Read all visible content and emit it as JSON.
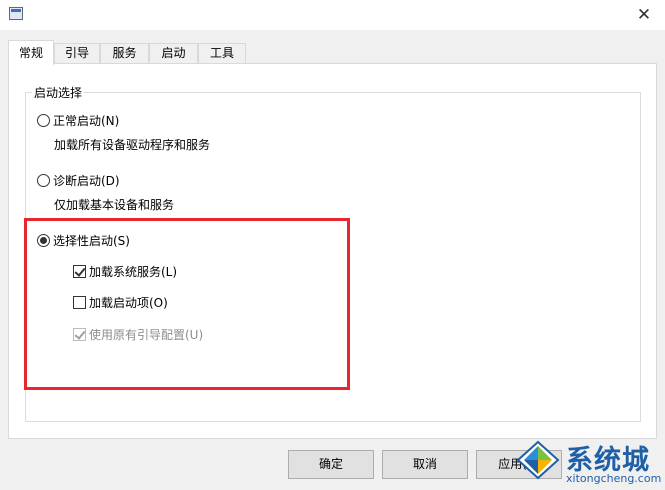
{
  "window": {
    "close_symbol": "✕"
  },
  "tabs": [
    {
      "label": "常规",
      "active": true
    },
    {
      "label": "引导"
    },
    {
      "label": "服务"
    },
    {
      "label": "启动"
    },
    {
      "label": "工具"
    }
  ],
  "startup_group": {
    "title": "启动选择",
    "normal": {
      "label": "正常启动(N)",
      "description": "加载所有设备驱动程序和服务",
      "selected": false
    },
    "diagnostic": {
      "label": "诊断启动(D)",
      "description": "仅加载基本设备和服务",
      "selected": false
    },
    "selective": {
      "label": "选择性启动(S)",
      "selected": true,
      "options": [
        {
          "label": "加载系统服务(L)",
          "checked": true,
          "enabled": true
        },
        {
          "label": "加载启动项(O)",
          "checked": false,
          "enabled": true
        },
        {
          "label": "使用原有引导配置(U)",
          "checked": true,
          "enabled": false
        }
      ]
    }
  },
  "buttons": {
    "ok": "确定",
    "cancel": "取消",
    "apply": "应用(A)"
  },
  "watermark": {
    "title": "系统城",
    "url": "xitongcheng.com"
  },
  "colors": {
    "highlight_box": "#e8262d",
    "watermark_blue": "#1f5fa8"
  }
}
